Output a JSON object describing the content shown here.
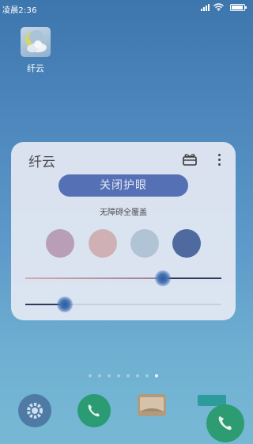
{
  "status_bar": {
    "time": "凌晨2:36",
    "battery_level": 0.9
  },
  "desktop": {
    "app_label": "纤云"
  },
  "widget": {
    "title": "纤云",
    "main_button_label": "关闭护眼",
    "sub_label": "无障碍全覆盖",
    "colors": {
      "panel_bg": "#e4e8f3",
      "button_bg": "#5570b4",
      "slider_active": "#2c3c5e"
    },
    "color_presets": [
      "#b99eb7",
      "#cfb1b4",
      "#b1c4d5",
      "#4f6a9f"
    ],
    "selected_preset_index": 3,
    "sliders": [
      {
        "name": "intensity",
        "value": 0.7
      },
      {
        "name": "brightness",
        "value": 0.2
      }
    ]
  },
  "home": {
    "page_count": 8,
    "active_page": 8
  },
  "dock": {
    "icons": [
      "gear-icon",
      "phone-icon",
      "message-icon"
    ],
    "floating": "phone-icon"
  }
}
